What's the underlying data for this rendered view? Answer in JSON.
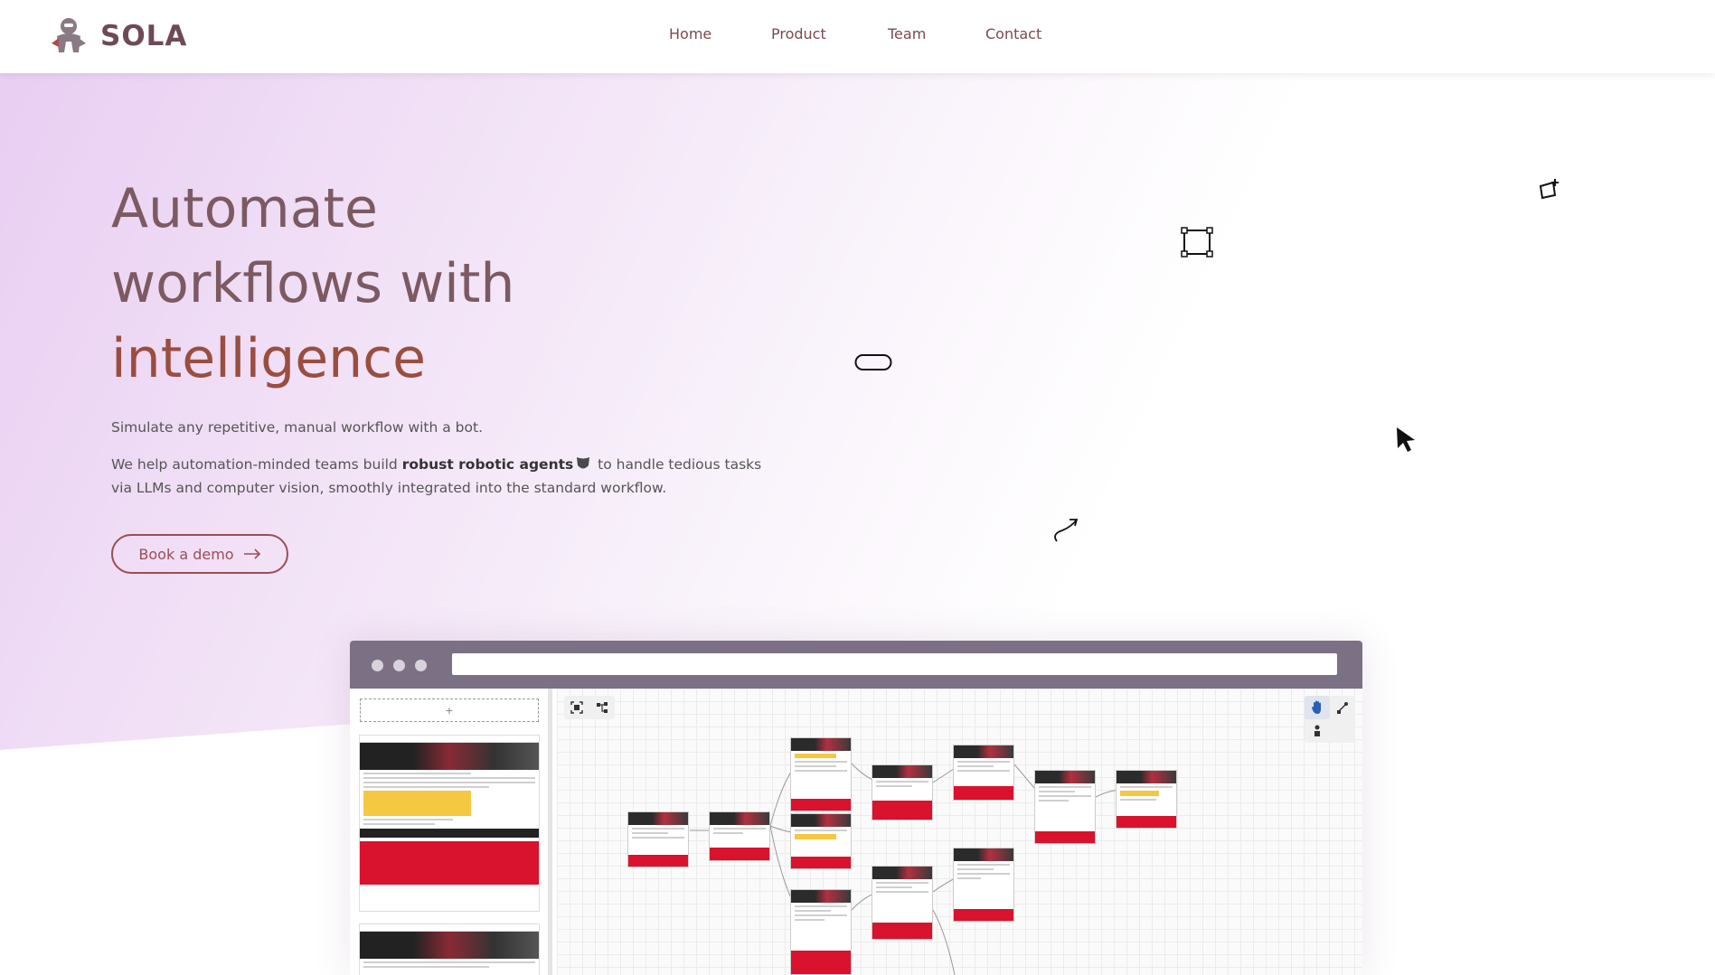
{
  "header": {
    "brand": "SOLA",
    "nav": {
      "home": "Home",
      "product": "Product",
      "team": "Team",
      "contact": "Contact"
    }
  },
  "hero": {
    "title_line1": "Automate",
    "title_line2": "workflows with",
    "title_line3": "intelligence",
    "subtitle": "Simulate any repetitive, manual workflow with a bot.",
    "desc_part1": "We help automation-minded teams build ",
    "desc_bold": "robust robotic agents",
    "desc_part2": " to handle tedious tasks via LLMs and computer vision, smoothly integrated into the standard workflow.",
    "cta_label": "Book a demo"
  },
  "app_preview": {
    "add_step_label": "+",
    "toolbar_icons": [
      "fit-view-icon",
      "layout-tree-icon"
    ],
    "mode_icons": [
      "hand-icon",
      "connect-icon",
      "pointer-icon"
    ]
  },
  "colors": {
    "brand": "#6e4a55",
    "accent": "#9a4e55",
    "title_highlight": "#9a4e40",
    "browser_bar": "#7c7085"
  }
}
